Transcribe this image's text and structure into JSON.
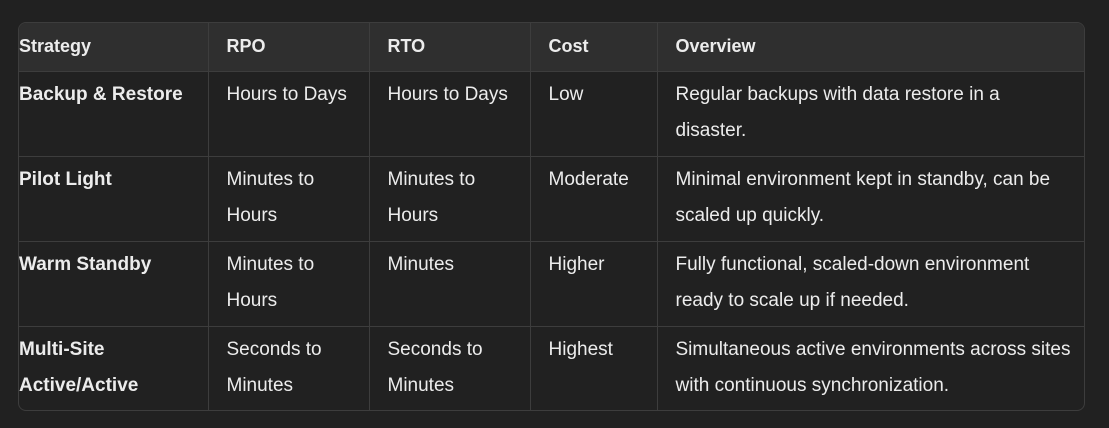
{
  "table": {
    "headers": [
      "Strategy",
      "RPO",
      "RTO",
      "Cost",
      "Overview"
    ],
    "rows": [
      {
        "strategy": "Backup & Restore",
        "rpo": "Hours to Days",
        "rto": "Hours to Days",
        "cost": "Low",
        "overview": "Regular backups with data restore in a disaster."
      },
      {
        "strategy": "Pilot Light",
        "rpo": "Minutes to Hours",
        "rto": "Minutes to Hours",
        "cost": "Moderate",
        "overview": "Minimal environment kept in standby, can be scaled up quickly."
      },
      {
        "strategy": "Warm Standby",
        "rpo": "Minutes to Hours",
        "rto": "Minutes",
        "cost": "Higher",
        "overview": "Fully functional, scaled-down environment ready to scale up if needed."
      },
      {
        "strategy": "Multi-Site Active/Active",
        "rpo": "Seconds to Minutes",
        "rto": "Seconds to Minutes",
        "cost": "Highest",
        "overview": "Simultaneous active environments across sites with continuous synchronization."
      }
    ]
  }
}
